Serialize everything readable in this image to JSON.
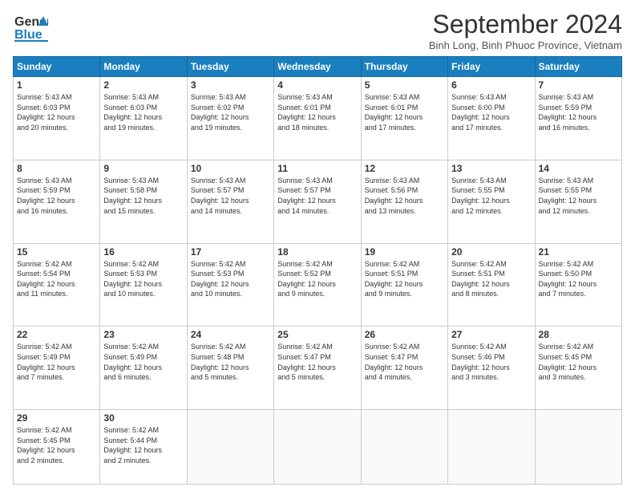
{
  "header": {
    "logo_line1": "General",
    "logo_line2": "Blue",
    "month": "September 2024",
    "location": "Binh Long, Binh Phuoc Province, Vietnam"
  },
  "weekdays": [
    "Sunday",
    "Monday",
    "Tuesday",
    "Wednesday",
    "Thursday",
    "Friday",
    "Saturday"
  ],
  "weeks": [
    [
      {
        "day": "1",
        "info": "Sunrise: 5:43 AM\nSunset: 6:03 PM\nDaylight: 12 hours\nand 20 minutes."
      },
      {
        "day": "2",
        "info": "Sunrise: 5:43 AM\nSunset: 6:03 PM\nDaylight: 12 hours\nand 19 minutes."
      },
      {
        "day": "3",
        "info": "Sunrise: 5:43 AM\nSunset: 6:02 PM\nDaylight: 12 hours\nand 19 minutes."
      },
      {
        "day": "4",
        "info": "Sunrise: 5:43 AM\nSunset: 6:01 PM\nDaylight: 12 hours\nand 18 minutes."
      },
      {
        "day": "5",
        "info": "Sunrise: 5:43 AM\nSunset: 6:01 PM\nDaylight: 12 hours\nand 17 minutes."
      },
      {
        "day": "6",
        "info": "Sunrise: 5:43 AM\nSunset: 6:00 PM\nDaylight: 12 hours\nand 17 minutes."
      },
      {
        "day": "7",
        "info": "Sunrise: 5:43 AM\nSunset: 5:59 PM\nDaylight: 12 hours\nand 16 minutes."
      }
    ],
    [
      {
        "day": "8",
        "info": "Sunrise: 5:43 AM\nSunset: 5:59 PM\nDaylight: 12 hours\nand 16 minutes."
      },
      {
        "day": "9",
        "info": "Sunrise: 5:43 AM\nSunset: 5:58 PM\nDaylight: 12 hours\nand 15 minutes."
      },
      {
        "day": "10",
        "info": "Sunrise: 5:43 AM\nSunset: 5:57 PM\nDaylight: 12 hours\nand 14 minutes."
      },
      {
        "day": "11",
        "info": "Sunrise: 5:43 AM\nSunset: 5:57 PM\nDaylight: 12 hours\nand 14 minutes."
      },
      {
        "day": "12",
        "info": "Sunrise: 5:43 AM\nSunset: 5:56 PM\nDaylight: 12 hours\nand 13 minutes."
      },
      {
        "day": "13",
        "info": "Sunrise: 5:43 AM\nSunset: 5:55 PM\nDaylight: 12 hours\nand 12 minutes."
      },
      {
        "day": "14",
        "info": "Sunrise: 5:43 AM\nSunset: 5:55 PM\nDaylight: 12 hours\nand 12 minutes."
      }
    ],
    [
      {
        "day": "15",
        "info": "Sunrise: 5:42 AM\nSunset: 5:54 PM\nDaylight: 12 hours\nand 11 minutes."
      },
      {
        "day": "16",
        "info": "Sunrise: 5:42 AM\nSunset: 5:53 PM\nDaylight: 12 hours\nand 10 minutes."
      },
      {
        "day": "17",
        "info": "Sunrise: 5:42 AM\nSunset: 5:53 PM\nDaylight: 12 hours\nand 10 minutes."
      },
      {
        "day": "18",
        "info": "Sunrise: 5:42 AM\nSunset: 5:52 PM\nDaylight: 12 hours\nand 9 minutes."
      },
      {
        "day": "19",
        "info": "Sunrise: 5:42 AM\nSunset: 5:51 PM\nDaylight: 12 hours\nand 9 minutes."
      },
      {
        "day": "20",
        "info": "Sunrise: 5:42 AM\nSunset: 5:51 PM\nDaylight: 12 hours\nand 8 minutes."
      },
      {
        "day": "21",
        "info": "Sunrise: 5:42 AM\nSunset: 5:50 PM\nDaylight: 12 hours\nand 7 minutes."
      }
    ],
    [
      {
        "day": "22",
        "info": "Sunrise: 5:42 AM\nSunset: 5:49 PM\nDaylight: 12 hours\nand 7 minutes."
      },
      {
        "day": "23",
        "info": "Sunrise: 5:42 AM\nSunset: 5:49 PM\nDaylight: 12 hours\nand 6 minutes."
      },
      {
        "day": "24",
        "info": "Sunrise: 5:42 AM\nSunset: 5:48 PM\nDaylight: 12 hours\nand 5 minutes."
      },
      {
        "day": "25",
        "info": "Sunrise: 5:42 AM\nSunset: 5:47 PM\nDaylight: 12 hours\nand 5 minutes."
      },
      {
        "day": "26",
        "info": "Sunrise: 5:42 AM\nSunset: 5:47 PM\nDaylight: 12 hours\nand 4 minutes."
      },
      {
        "day": "27",
        "info": "Sunrise: 5:42 AM\nSunset: 5:46 PM\nDaylight: 12 hours\nand 3 minutes."
      },
      {
        "day": "28",
        "info": "Sunrise: 5:42 AM\nSunset: 5:45 PM\nDaylight: 12 hours\nand 3 minutes."
      }
    ],
    [
      {
        "day": "29",
        "info": "Sunrise: 5:42 AM\nSunset: 5:45 PM\nDaylight: 12 hours\nand 2 minutes."
      },
      {
        "day": "30",
        "info": "Sunrise: 5:42 AM\nSunset: 5:44 PM\nDaylight: 12 hours\nand 2 minutes."
      },
      {
        "day": "",
        "info": ""
      },
      {
        "day": "",
        "info": ""
      },
      {
        "day": "",
        "info": ""
      },
      {
        "day": "",
        "info": ""
      },
      {
        "day": "",
        "info": ""
      }
    ]
  ]
}
